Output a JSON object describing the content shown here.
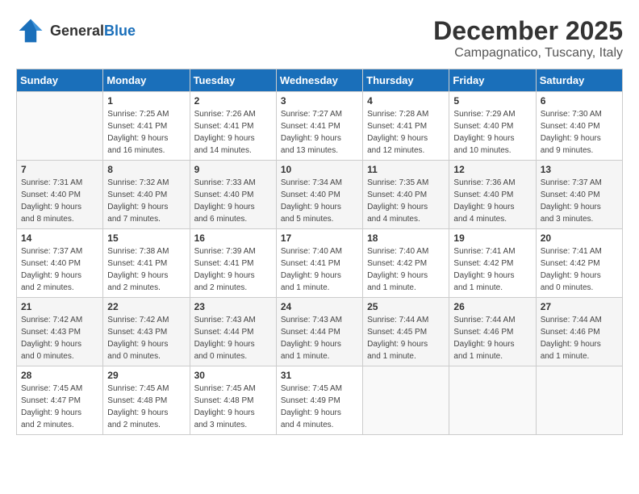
{
  "header": {
    "logo_general": "General",
    "logo_blue": "Blue",
    "month": "December 2025",
    "location": "Campagnatico, Tuscany, Italy"
  },
  "weekdays": [
    "Sunday",
    "Monday",
    "Tuesday",
    "Wednesday",
    "Thursday",
    "Friday",
    "Saturday"
  ],
  "weeks": [
    [
      {
        "day": "",
        "info": ""
      },
      {
        "day": "1",
        "info": "Sunrise: 7:25 AM\nSunset: 4:41 PM\nDaylight: 9 hours\nand 16 minutes."
      },
      {
        "day": "2",
        "info": "Sunrise: 7:26 AM\nSunset: 4:41 PM\nDaylight: 9 hours\nand 14 minutes."
      },
      {
        "day": "3",
        "info": "Sunrise: 7:27 AM\nSunset: 4:41 PM\nDaylight: 9 hours\nand 13 minutes."
      },
      {
        "day": "4",
        "info": "Sunrise: 7:28 AM\nSunset: 4:41 PM\nDaylight: 9 hours\nand 12 minutes."
      },
      {
        "day": "5",
        "info": "Sunrise: 7:29 AM\nSunset: 4:40 PM\nDaylight: 9 hours\nand 10 minutes."
      },
      {
        "day": "6",
        "info": "Sunrise: 7:30 AM\nSunset: 4:40 PM\nDaylight: 9 hours\nand 9 minutes."
      }
    ],
    [
      {
        "day": "7",
        "info": "Sunrise: 7:31 AM\nSunset: 4:40 PM\nDaylight: 9 hours\nand 8 minutes."
      },
      {
        "day": "8",
        "info": "Sunrise: 7:32 AM\nSunset: 4:40 PM\nDaylight: 9 hours\nand 7 minutes."
      },
      {
        "day": "9",
        "info": "Sunrise: 7:33 AM\nSunset: 4:40 PM\nDaylight: 9 hours\nand 6 minutes."
      },
      {
        "day": "10",
        "info": "Sunrise: 7:34 AM\nSunset: 4:40 PM\nDaylight: 9 hours\nand 5 minutes."
      },
      {
        "day": "11",
        "info": "Sunrise: 7:35 AM\nSunset: 4:40 PM\nDaylight: 9 hours\nand 4 minutes."
      },
      {
        "day": "12",
        "info": "Sunrise: 7:36 AM\nSunset: 4:40 PM\nDaylight: 9 hours\nand 4 minutes."
      },
      {
        "day": "13",
        "info": "Sunrise: 7:37 AM\nSunset: 4:40 PM\nDaylight: 9 hours\nand 3 minutes."
      }
    ],
    [
      {
        "day": "14",
        "info": "Sunrise: 7:37 AM\nSunset: 4:40 PM\nDaylight: 9 hours\nand 2 minutes."
      },
      {
        "day": "15",
        "info": "Sunrise: 7:38 AM\nSunset: 4:41 PM\nDaylight: 9 hours\nand 2 minutes."
      },
      {
        "day": "16",
        "info": "Sunrise: 7:39 AM\nSunset: 4:41 PM\nDaylight: 9 hours\nand 2 minutes."
      },
      {
        "day": "17",
        "info": "Sunrise: 7:40 AM\nSunset: 4:41 PM\nDaylight: 9 hours\nand 1 minute."
      },
      {
        "day": "18",
        "info": "Sunrise: 7:40 AM\nSunset: 4:42 PM\nDaylight: 9 hours\nand 1 minute."
      },
      {
        "day": "19",
        "info": "Sunrise: 7:41 AM\nSunset: 4:42 PM\nDaylight: 9 hours\nand 1 minute."
      },
      {
        "day": "20",
        "info": "Sunrise: 7:41 AM\nSunset: 4:42 PM\nDaylight: 9 hours\nand 0 minutes."
      }
    ],
    [
      {
        "day": "21",
        "info": "Sunrise: 7:42 AM\nSunset: 4:43 PM\nDaylight: 9 hours\nand 0 minutes."
      },
      {
        "day": "22",
        "info": "Sunrise: 7:42 AM\nSunset: 4:43 PM\nDaylight: 9 hours\nand 0 minutes."
      },
      {
        "day": "23",
        "info": "Sunrise: 7:43 AM\nSunset: 4:44 PM\nDaylight: 9 hours\nand 0 minutes."
      },
      {
        "day": "24",
        "info": "Sunrise: 7:43 AM\nSunset: 4:44 PM\nDaylight: 9 hours\nand 1 minute."
      },
      {
        "day": "25",
        "info": "Sunrise: 7:44 AM\nSunset: 4:45 PM\nDaylight: 9 hours\nand 1 minute."
      },
      {
        "day": "26",
        "info": "Sunrise: 7:44 AM\nSunset: 4:46 PM\nDaylight: 9 hours\nand 1 minute."
      },
      {
        "day": "27",
        "info": "Sunrise: 7:44 AM\nSunset: 4:46 PM\nDaylight: 9 hours\nand 1 minute."
      }
    ],
    [
      {
        "day": "28",
        "info": "Sunrise: 7:45 AM\nSunset: 4:47 PM\nDaylight: 9 hours\nand 2 minutes."
      },
      {
        "day": "29",
        "info": "Sunrise: 7:45 AM\nSunset: 4:48 PM\nDaylight: 9 hours\nand 2 minutes."
      },
      {
        "day": "30",
        "info": "Sunrise: 7:45 AM\nSunset: 4:48 PM\nDaylight: 9 hours\nand 3 minutes."
      },
      {
        "day": "31",
        "info": "Sunrise: 7:45 AM\nSunset: 4:49 PM\nDaylight: 9 hours\nand 4 minutes."
      },
      {
        "day": "",
        "info": ""
      },
      {
        "day": "",
        "info": ""
      },
      {
        "day": "",
        "info": ""
      }
    ]
  ]
}
